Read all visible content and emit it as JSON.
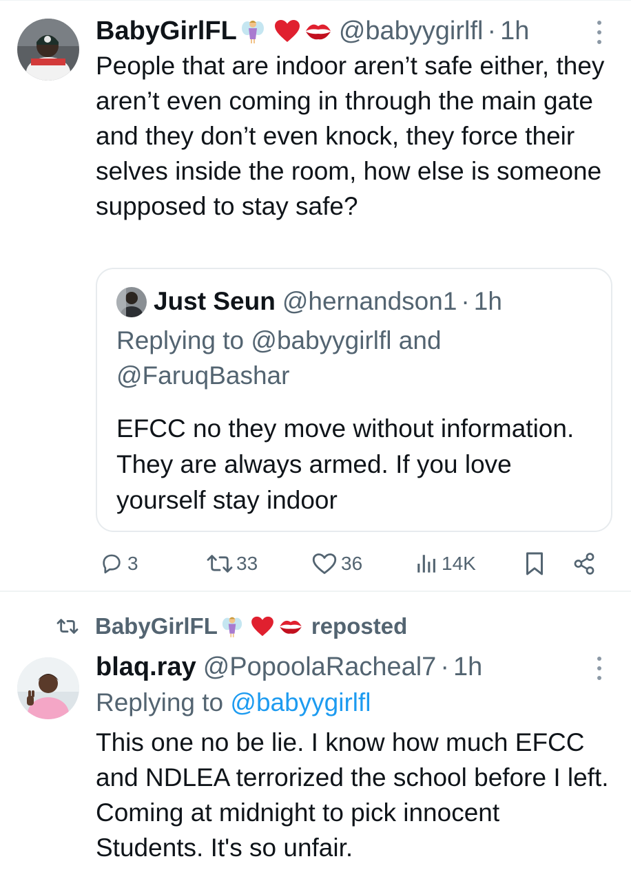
{
  "tweet1": {
    "author_name": "BabyGirlFL",
    "author_handle": "@babyygirlfl",
    "dot": "·",
    "time": "1h",
    "emoji_icons": [
      "fairy-emoji",
      "red-heart-emoji",
      "kiss-mark-emoji"
    ],
    "text": "People that are indoor aren’t safe either, they aren’t even coming in through the main gate and they don’t even knock, they force their selves inside the room, how else is someone supposed to stay safe?",
    "quote": {
      "author_name": "Just Seun",
      "author_handle": "@hernandson1",
      "dot": "·",
      "time": "1h",
      "replying_to": "Replying to @babyygirlfl and @FaruqBashar",
      "text": "EFCC no they move without information. They are always armed. If you love yourself stay indoor"
    },
    "actions": {
      "replies": "3",
      "reposts": "33",
      "likes": "36",
      "views": "14K"
    }
  },
  "tweet2": {
    "reposted_by": "BabyGirlFL",
    "reposted_label": "reposted",
    "author_name": "blaq.ray",
    "author_handle": "@PopoolaRacheal7",
    "dot": "·",
    "time": "1h",
    "replying_prefix": "Replying to",
    "replying_handle": "@babyygirlfl",
    "text": "This one no be lie. I know how much EFCC and NDLEA terrorized the school before I left. Coming at midnight to pick innocent Students. It's so unfair."
  },
  "colors": {
    "text": "#0f1419",
    "secondary": "#536471",
    "link": "#1d9bf0",
    "border": "#e7ebee",
    "heart": "#e0202f"
  }
}
